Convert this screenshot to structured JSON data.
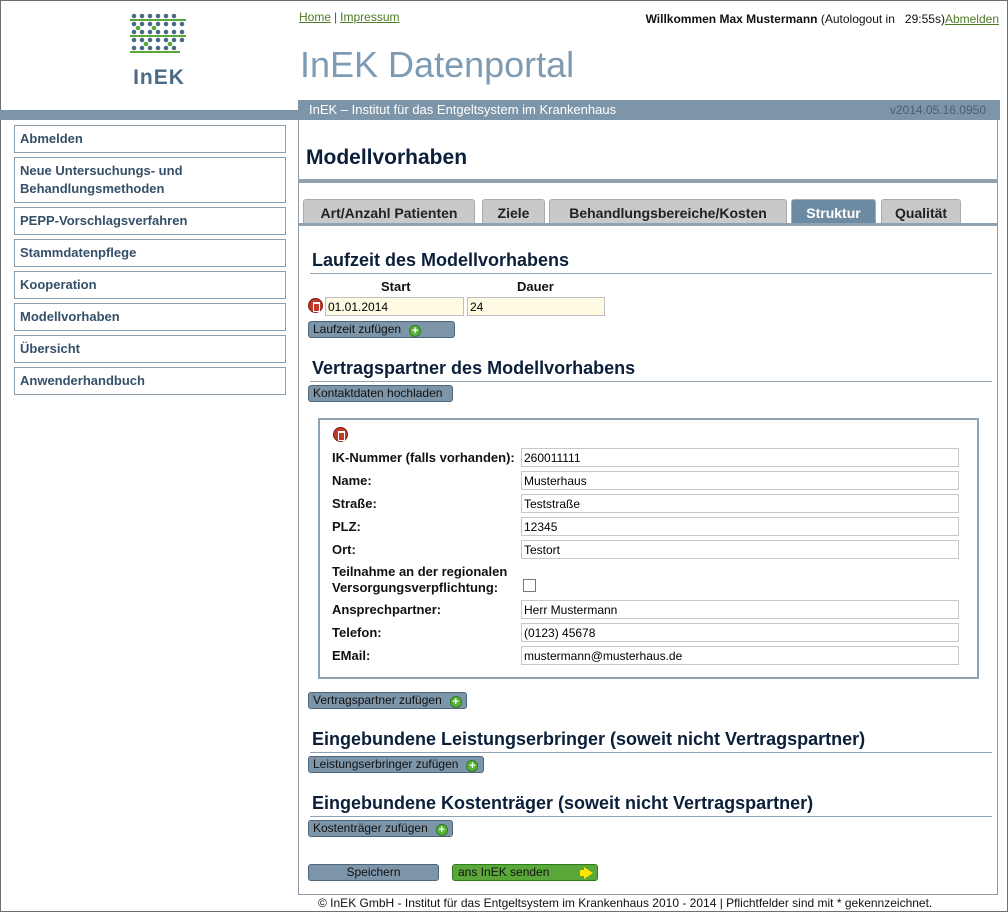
{
  "logo": {
    "text": "InEK"
  },
  "top_links": {
    "home": "Home",
    "separator": "|",
    "impressum": "Impressum"
  },
  "user": {
    "welcome": "Willkommen Max Mustermann",
    "autologout": "(Autologout in",
    "timer": "29:55s)",
    "logout_link": "Abmelden"
  },
  "portal_title": "InEK Datenportal",
  "band": {
    "institute": "InEK – Institut für das Entgeltsystem im Krankenhaus",
    "version": "v2014.05.16.0950"
  },
  "sidebar": {
    "items": [
      {
        "label": "Abmelden"
      },
      {
        "label": "Neue Untersuchungs- und Behandlungsmethoden"
      },
      {
        "label": "PEPP-Vorschlagsverfahren"
      },
      {
        "label": "Stammdatenpflege"
      },
      {
        "label": "Kooperation"
      },
      {
        "label": "Modellvorhaben"
      },
      {
        "label": "Übersicht"
      },
      {
        "label": "Anwenderhandbuch"
      }
    ]
  },
  "page_title": "Modellvorhaben",
  "tabs": [
    {
      "label": "Art/Anzahl Patienten"
    },
    {
      "label": "Ziele"
    },
    {
      "label": "Behandlungsbereiche/Kosten"
    },
    {
      "label": "Struktur",
      "active": true
    },
    {
      "label": "Qualität"
    }
  ],
  "laufzeit": {
    "heading": "Laufzeit des Modellvorhabens",
    "col_start": "Start",
    "col_dauer": "Dauer",
    "start_value": "01.01.2014",
    "dauer_value": "24",
    "add_button": "Laufzeit zufügen"
  },
  "vertragspartner": {
    "heading": "Vertragspartner des Modellvorhabens",
    "upload_button": "Kontaktdaten hochladen",
    "fields": {
      "ik_label": "IK-Nummer (falls vorhanden):",
      "ik_value": "260011111",
      "name_label": "Name:",
      "name_value": "Musterhaus",
      "strasse_label": "Straße:",
      "strasse_value": "Teststraße",
      "plz_label": "PLZ:",
      "plz_value": "12345",
      "ort_label": "Ort:",
      "ort_value": "Testort",
      "teilnahme_label_1": "Teilnahme an der regionalen",
      "teilnahme_label_2": "Versorgungsverpflichtung:",
      "teilnahme_checked": false,
      "ansprech_label": "Ansprechpartner:",
      "ansprech_value": "Herr Mustermann",
      "telefon_label": "Telefon:",
      "telefon_value": "(0123) 45678",
      "email_label": "EMail:",
      "email_value": "mustermann@musterhaus.de"
    },
    "add_button": "Vertragspartner zufügen"
  },
  "leistungserbringer": {
    "heading": "Eingebundene Leistungserbringer (soweit nicht Vertragspartner)",
    "add_button": "Leistungserbringer zufügen"
  },
  "kostentraeger": {
    "heading": "Eingebundene Kostenträger (soweit nicht Vertragspartner)",
    "add_button": "Kostenträger zufügen"
  },
  "actions": {
    "save": "Speichern",
    "send": "ans InEK senden"
  },
  "footer": "© InEK GmbH - Institut für das Entgeltsystem im Krankenhaus 2010 - 2014 | Pflichtfelder sind mit * gekennzeichnet.",
  "colors": {
    "accent": "#7c95a9",
    "title": "#7f9bb3",
    "link_green": "#4d7a24",
    "send_green": "#5aa83a"
  }
}
